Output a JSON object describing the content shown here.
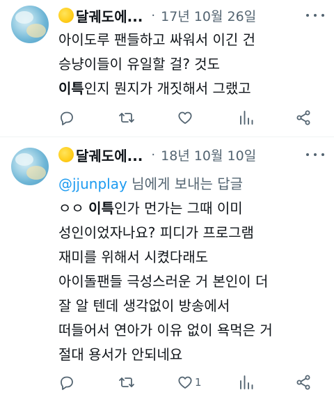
{
  "tweets": [
    {
      "display_name": "달궤도에...",
      "dot": "·",
      "date": "17년 10월 26일",
      "reply_to_prefix": "",
      "reply_to_handle": "",
      "reply_to_suffix": "",
      "lines": [
        {
          "pre": "아이도루 팬들하고 싸워서 이긴 건",
          "bold": "",
          "post": ""
        },
        {
          "pre": "승냥이들이 유일할 걸? 것도",
          "bold": "",
          "post": ""
        },
        {
          "pre": "",
          "bold": "이특",
          "post": "인지 뭔지가 개짓해서 그랬고"
        }
      ],
      "actions": {
        "reply_count": "",
        "retweet_count": "",
        "like_count": "",
        "views_count": ""
      }
    },
    {
      "display_name": "달궤도에...",
      "dot": "·",
      "date": "18년 10월 10일",
      "reply_to_prefix": "",
      "reply_to_handle": "@jjunplay",
      "reply_to_suffix": " 님에게 보내는 답글",
      "lines": [
        {
          "pre": "ㅇㅇ ",
          "bold": "이특",
          "post": "인가 먼가는 그때 이미"
        },
        {
          "pre": "성인이었자나요? 피디가 프로그램",
          "bold": "",
          "post": ""
        },
        {
          "pre": "재미를 위해서 시켰다래도",
          "bold": "",
          "post": ""
        },
        {
          "pre": "아이돌팬들 극성스러운 거 본인이 더",
          "bold": "",
          "post": ""
        },
        {
          "pre": "잘 알 텐데 생각없이 방송에서",
          "bold": "",
          "post": ""
        },
        {
          "pre": "떠들어서 연아가 이유 없이 욕먹은 거",
          "bold": "",
          "post": ""
        },
        {
          "pre": "절대 용서가 안되네요",
          "bold": "",
          "post": ""
        }
      ],
      "actions": {
        "reply_count": "",
        "retweet_count": "",
        "like_count": "1",
        "views_count": ""
      }
    }
  ],
  "colors": {
    "text": "#0f1419",
    "secondary": "#536471",
    "link": "#1d9bf0",
    "divider": "#eff3f4"
  },
  "icons": [
    "reply-icon",
    "retweet-icon",
    "like-icon",
    "views-icon",
    "share-icon",
    "more-icon",
    "crescent-moon-emoji"
  ]
}
